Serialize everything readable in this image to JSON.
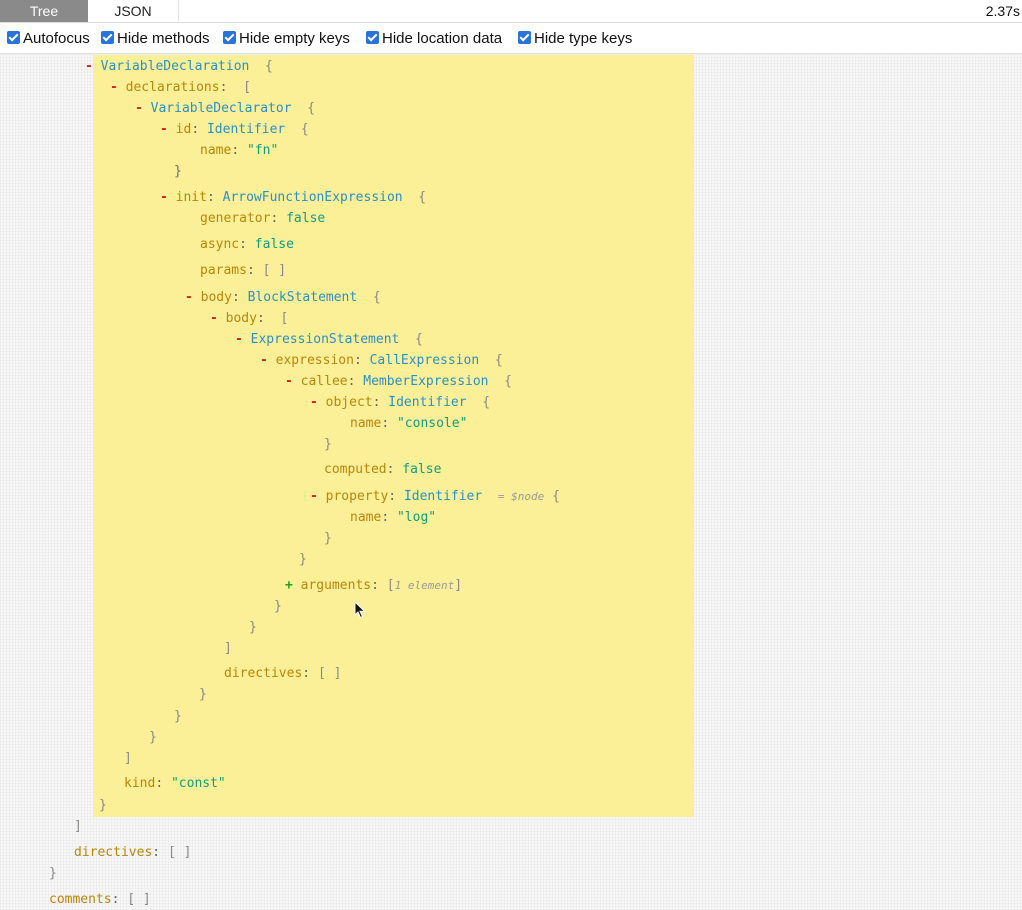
{
  "tabs": {
    "tree": "Tree",
    "json": "JSON"
  },
  "timing": "2.37s",
  "options": [
    {
      "label": "Autofocus",
      "checked": true
    },
    {
      "label": "Hide methods",
      "checked": true
    },
    {
      "label": "Hide empty keys",
      "checked": true
    },
    {
      "label": "Hide location data",
      "checked": true
    },
    {
      "label": "Hide type keys",
      "checked": true
    }
  ],
  "tree": {
    "minus": "-",
    "plus": "+",
    "colon": ":",
    "obrace": "{",
    "cbrace": "}",
    "obracket": "[",
    "cbracket": "]",
    "empty_array": "[ ]",
    "VariableDeclaration": "VariableDeclaration",
    "declarations": "declarations",
    "VariableDeclarator": "VariableDeclarator",
    "id": "id",
    "Identifier": "Identifier",
    "name": "name",
    "fn_value": "\"fn\"",
    "init": "init",
    "ArrowFunctionExpression": "ArrowFunctionExpression",
    "generator": "generator",
    "false": "false",
    "async": "async",
    "params": "params",
    "body": "body",
    "BlockStatement": "BlockStatement",
    "ExpressionStatement": "ExpressionStatement",
    "expression": "expression",
    "CallExpression": "CallExpression",
    "callee": "callee",
    "MemberExpression": "MemberExpression",
    "object": "object",
    "console_value": "\"console\"",
    "computed": "computed",
    "property": "property",
    "node_ref": "= $node",
    "log_value": "\"log\"",
    "arguments": "arguments",
    "arguments_summary": "1 element",
    "directives": "directives",
    "kind": "kind",
    "const_value": "\"const\"",
    "comments": "comments"
  }
}
